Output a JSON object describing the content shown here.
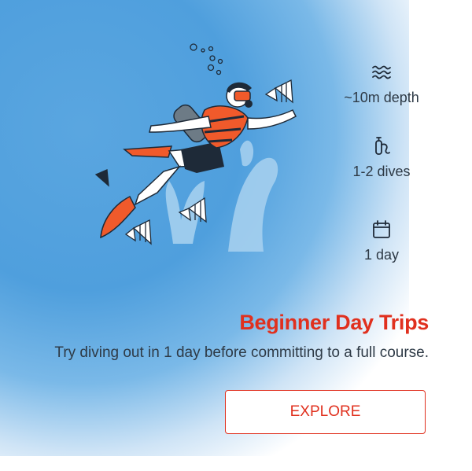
{
  "stats": [
    {
      "icon": "waves-icon",
      "label": "~10m depth"
    },
    {
      "icon": "scuba-tank-icon",
      "label": "1-2 dives"
    },
    {
      "icon": "calendar-icon",
      "label": "1 day"
    }
  ],
  "card": {
    "title": "Beginner Day Trips",
    "subtitle": "Try diving out in 1 day before committing to a full course.",
    "cta_label": "EXPLORE"
  },
  "colors": {
    "accent": "#e0301e",
    "water": "#4f9fdd",
    "text": "#2e3a46"
  },
  "illustration": {
    "icon": "scuba-diver-illustration"
  }
}
